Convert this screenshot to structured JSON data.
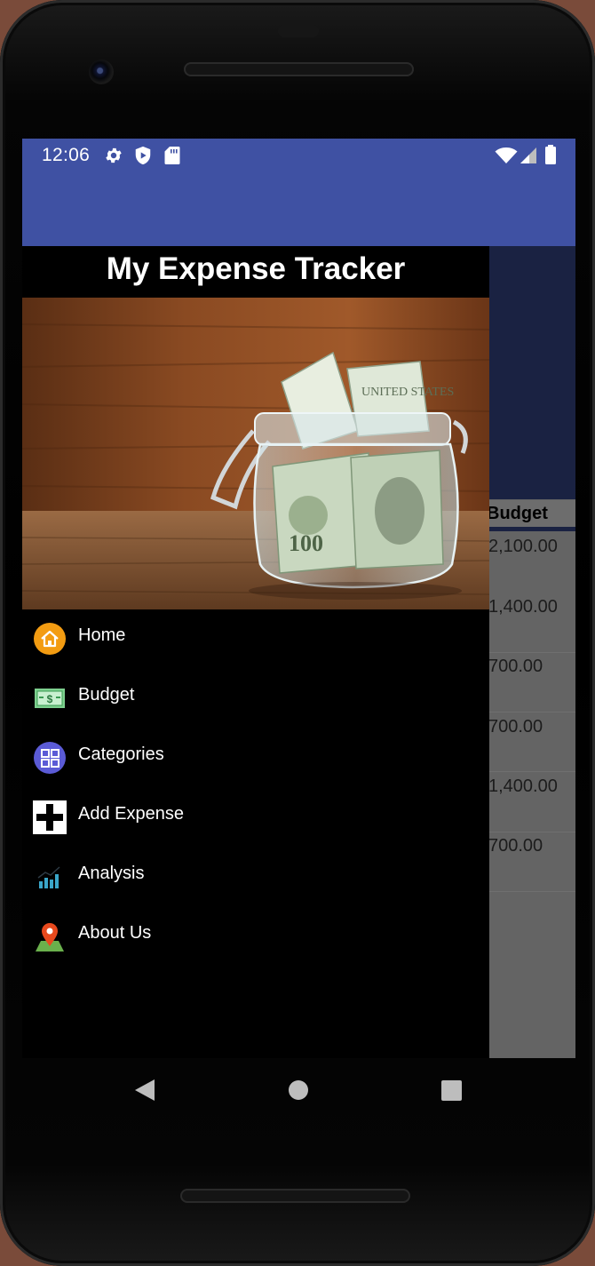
{
  "status_bar": {
    "time": "12:06",
    "left_icons": [
      "gear-icon",
      "shield-play-icon",
      "sd-card-icon"
    ],
    "right_icons": [
      "wifi-icon",
      "signal-icon",
      "battery-icon"
    ]
  },
  "colors": {
    "app_bar": "#3f51a3",
    "drawer_bg": "#000000",
    "scrim_bg": "#5f5f5f"
  },
  "drawer": {
    "title": "My Expense Tracker",
    "hero_image": "money-jar-image",
    "items": [
      {
        "label": "Home",
        "icon": "home-icon"
      },
      {
        "label": "Budget",
        "icon": "budget-bill-icon"
      },
      {
        "label": "Categories",
        "icon": "categories-grid-icon"
      },
      {
        "label": "Add Expense",
        "icon": "plus-icon"
      },
      {
        "label": "Analysis",
        "icon": "bar-chart-icon"
      },
      {
        "label": "About Us",
        "icon": "location-pin-icon"
      }
    ]
  },
  "background_table": {
    "column_header": "Budget",
    "values": [
      "2,100.00",
      "1,400.00",
      "700.00",
      "700.00",
      "1,400.00",
      "700.00"
    ]
  },
  "nav_bar": {
    "buttons": [
      "back-icon",
      "home-circle-icon",
      "recents-icon"
    ]
  }
}
